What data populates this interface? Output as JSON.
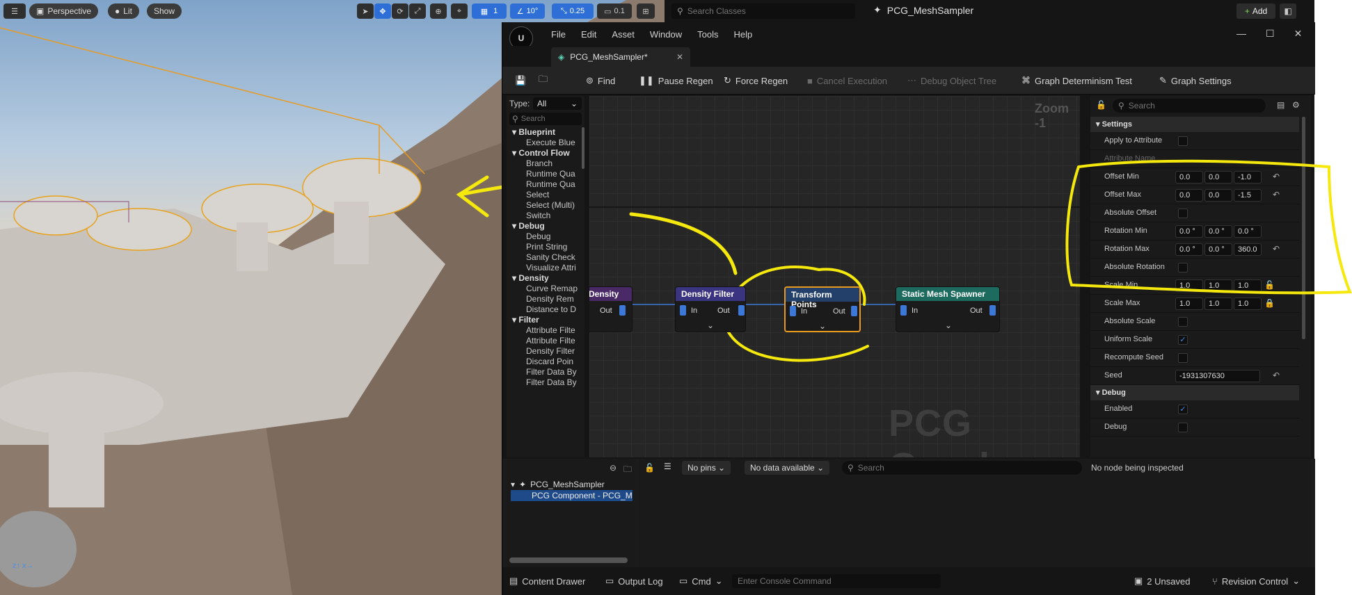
{
  "viewport": {
    "perspective": "Perspective",
    "lit": "Lit",
    "show": "Show",
    "grid_size": "1",
    "angle": "10°",
    "scale": "0.25",
    "camera_speed": "0.1"
  },
  "topbar": {
    "search_placeholder": "Search Classes",
    "asset_name": "PCG_MeshSampler",
    "add_label": "Add"
  },
  "menu": [
    "File",
    "Edit",
    "Asset",
    "Window",
    "Tools",
    "Help"
  ],
  "tab": {
    "label": "PCG_MeshSampler*"
  },
  "toolbar": {
    "find": "Find",
    "pause_regen": "Pause Regen",
    "force_regen": "Force Regen",
    "cancel_execution": "Cancel Execution",
    "debug_object_tree": "Debug Object Tree",
    "graph_determinism": "Graph Determinism Test",
    "graph_settings": "Graph Settings"
  },
  "palette": {
    "type_label": "Type:",
    "type_value": "All",
    "search_placeholder": "Search",
    "cat_blueprint": "Blueprint",
    "item_execute": "Execute Blue",
    "cat_control": "Control Flow",
    "item_branch": "Branch",
    "item_runtime1": "Runtime Qua",
    "item_runtime2": "Runtime Qua",
    "item_select": "Select",
    "item_select_multi": "Select (Multi)",
    "item_switch": "Switch",
    "cat_debug": "Debug",
    "item_debug": "Debug",
    "item_print": "Print String",
    "item_sanity": "Sanity Check",
    "item_visualize": "Visualize Attri",
    "cat_density": "Density",
    "item_curve": "Curve Remap",
    "item_density_rem": "Density Rem",
    "item_distance": "Distance to D",
    "cat_filter": "Filter",
    "item_attr1": "Attribute Filte",
    "item_attr2": "Attribute Filte",
    "item_density_filter": "Density Filter",
    "item_discard": "Discard Poin",
    "item_filter1": "Filter Data By",
    "item_filter2": "Filter Data By"
  },
  "graph": {
    "zoom": "Zoom -1",
    "watermark": "PCG Graph",
    "node_density": "Density",
    "node_density_filter": "Density Filter",
    "node_transform": "Transform Points",
    "node_spawner": "Static Mesh Spawner",
    "pin_in": "In",
    "pin_out": "Out"
  },
  "details": {
    "search_placeholder": "Search",
    "section_settings": "Settings",
    "apply_to_attribute": "Apply to Attribute",
    "attribute_name": "Attribute Name",
    "offset_min": "Offset Min",
    "offset_min_vals": [
      "0.0",
      "0.0",
      "-1.0"
    ],
    "offset_max": "Offset Max",
    "offset_max_vals": [
      "0.0",
      "0.0",
      "-1.5"
    ],
    "absolute_offset": "Absolute Offset",
    "rotation_min": "Rotation Min",
    "rotation_min_vals": [
      "0.0 °",
      "0.0 °",
      "0.0 °"
    ],
    "rotation_max": "Rotation Max",
    "rotation_max_vals": [
      "0.0 °",
      "0.0 °",
      "360.0"
    ],
    "absolute_rotation": "Absolute Rotation",
    "scale_min": "Scale Min",
    "scale_min_vals": [
      "1.0",
      "1.0",
      "1.0"
    ],
    "scale_max": "Scale Max",
    "scale_max_vals": [
      "1.0",
      "1.0",
      "1.0"
    ],
    "absolute_scale": "Absolute Scale",
    "uniform_scale": "Uniform Scale",
    "recompute_seed": "Recompute Seed",
    "seed": "Seed",
    "seed_value": "-1931307630",
    "section_debug": "Debug",
    "enabled": "Enabled",
    "debug": "Debug"
  },
  "bottom": {
    "tree_root": "PCG_MeshSampler",
    "tree_child": "PCG Component - PCG_MeshS",
    "no_pins": "No pins",
    "no_data": "No data available",
    "search_placeholder": "Search",
    "inspect_msg": "No node being inspected"
  },
  "status": {
    "content_drawer": "Content Drawer",
    "output_log": "Output Log",
    "cmd": "Cmd",
    "console_placeholder": "Enter Console Command",
    "unsaved": "2 Unsaved",
    "revision": "Revision Control"
  },
  "colors": {
    "accent_blue": "#2d6fd6",
    "node_orange_outline": "#e89b1f",
    "annotation_yellow": "#f5e80d"
  }
}
